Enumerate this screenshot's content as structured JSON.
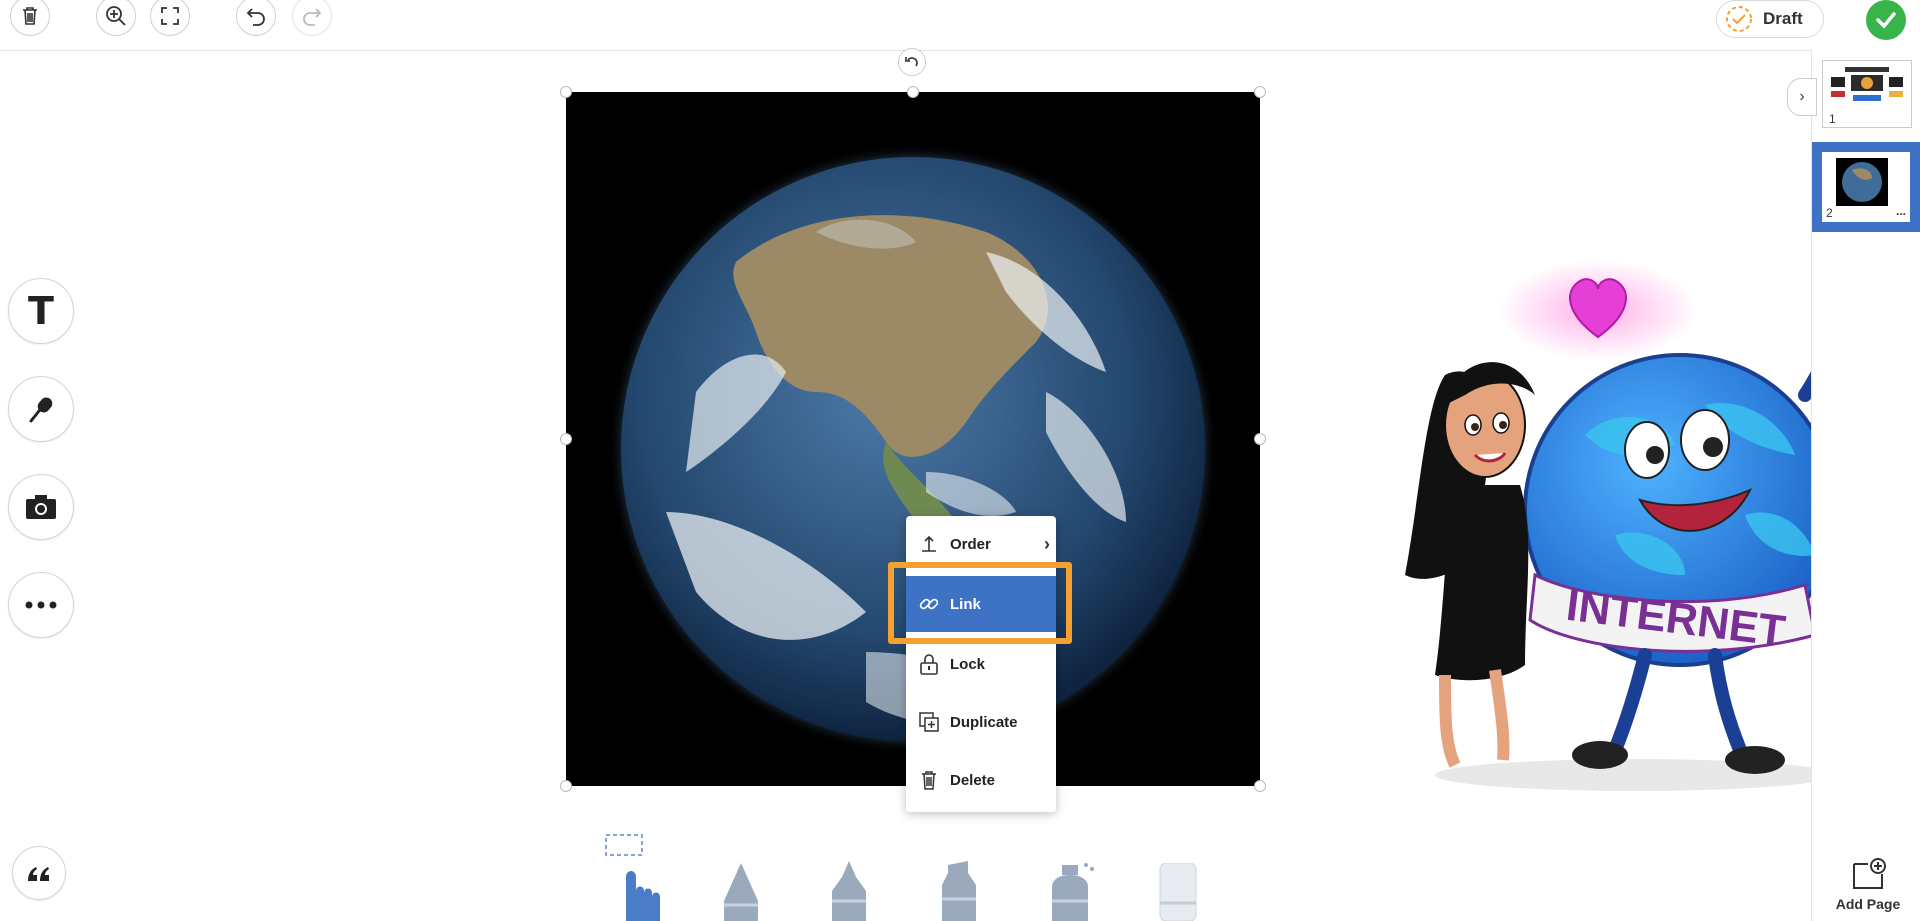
{
  "toolbar": {
    "delete_icon": "trash-icon",
    "zoom_icon": "zoom-in-icon",
    "fullscreen_icon": "fullscreen-icon",
    "undo_icon": "undo-icon",
    "redo_icon": "redo-icon",
    "draft_label": "Draft",
    "done_icon": "checkmark-icon"
  },
  "left_tools": {
    "text_label": "T",
    "mic_icon": "microphone-icon",
    "camera_icon": "camera-icon",
    "more_icon": "more-icon",
    "quote_icon": "quote-icon"
  },
  "context_menu": {
    "order": "Order",
    "link": "Link",
    "lock": "Lock",
    "duplicate": "Duplicate",
    "delete": "Delete"
  },
  "sticker": {
    "banner_text": "INTERNET"
  },
  "pages": [
    {
      "number": "1"
    },
    {
      "number": "2"
    }
  ],
  "page2_more": "...",
  "add_page_label": "Add Page",
  "colors": {
    "accent_blue": "#3d72c5",
    "highlight_orange": "#f4a131",
    "done_green": "#38b54a"
  }
}
